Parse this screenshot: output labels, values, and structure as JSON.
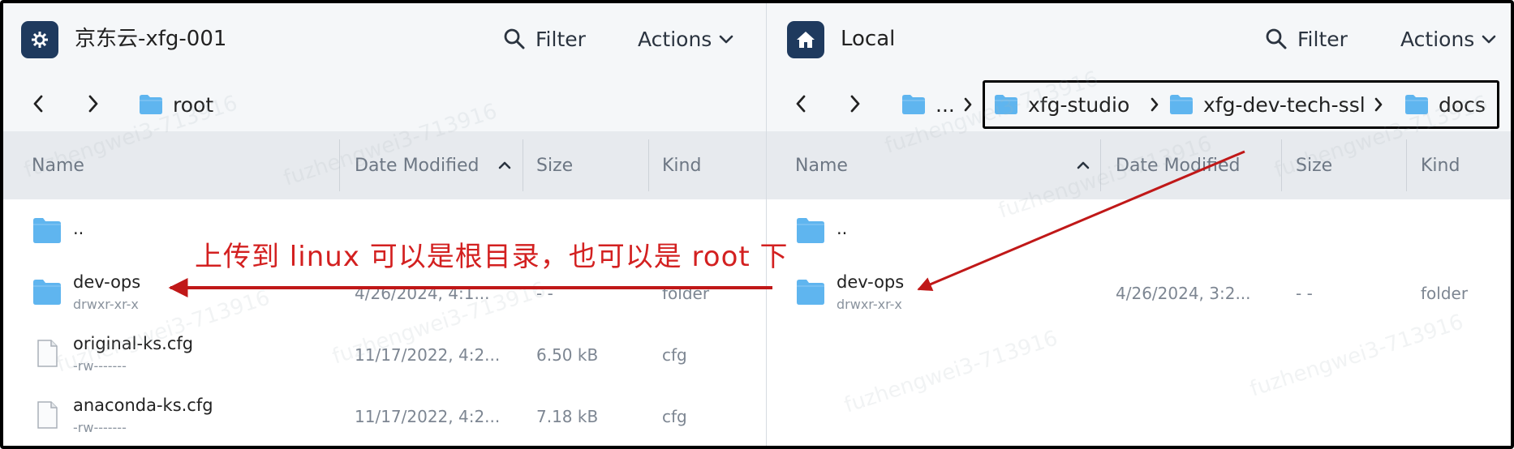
{
  "left_pane": {
    "host_title": "京东云-xfg-001",
    "filter_label": "Filter",
    "actions_label": "Actions",
    "path": [
      "root"
    ],
    "columns": {
      "name": "Name",
      "date": "Date Modified",
      "size": "Size",
      "kind": "Kind"
    },
    "rows": [
      {
        "name": "..",
        "perm": "",
        "date": "",
        "size": "",
        "kind": "",
        "icon": "folder-icon"
      },
      {
        "name": "dev-ops",
        "perm": "drwxr-xr-x",
        "date": "4/26/2024, 4:1...",
        "size": "- -",
        "kind": "folder",
        "icon": "folder-icon"
      },
      {
        "name": "original-ks.cfg",
        "perm": "-rw-------",
        "date": "11/17/2022, 4:2...",
        "size": "6.50 kB",
        "kind": "cfg",
        "icon": "file-icon"
      },
      {
        "name": "anaconda-ks.cfg",
        "perm": "-rw-------",
        "date": "11/17/2022, 4:2...",
        "size": "7.18 kB",
        "kind": "cfg",
        "icon": "file-icon"
      }
    ]
  },
  "right_pane": {
    "host_title": "Local",
    "filter_label": "Filter",
    "actions_label": "Actions",
    "path_ellipsis": "...",
    "path": [
      "xfg-studio",
      "xfg-dev-tech-ssl",
      "docs"
    ],
    "columns": {
      "name": "Name",
      "date": "Date Modified",
      "size": "Size",
      "kind": "Kind"
    },
    "rows": [
      {
        "name": "..",
        "perm": "",
        "date": "",
        "size": "",
        "kind": "",
        "icon": "folder-icon"
      },
      {
        "name": "dev-ops",
        "perm": "drwxr-xr-x",
        "date": "4/26/2024, 3:2...",
        "size": "- -",
        "kind": "folder",
        "icon": "folder-icon"
      }
    ]
  },
  "annotation": {
    "text": "上传到 linux 可以是根目录，也可以是 root 下",
    "color": "#d32020"
  },
  "watermark": "fuzhengwei3-713916",
  "colors": {
    "folder": "#5fb5ef",
    "app_icon_bg": "#1f3a5e",
    "header_bg": "#f5f7f9",
    "column_header_bg": "#e7eaee"
  }
}
